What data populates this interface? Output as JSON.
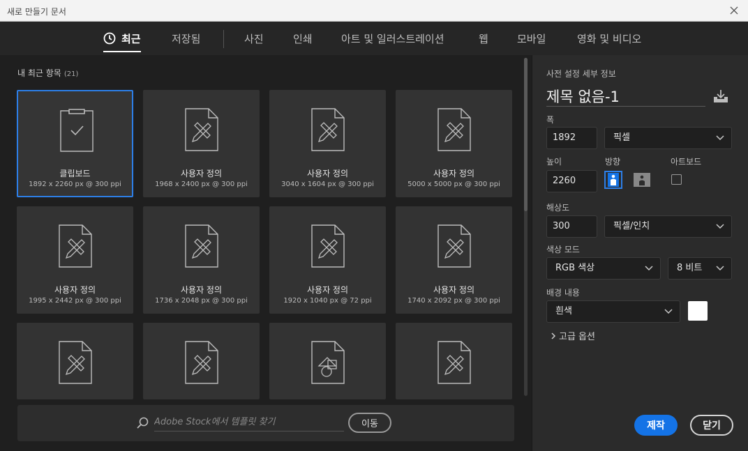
{
  "window": {
    "title": "새로 만들기 문서"
  },
  "tabs": [
    {
      "label": "최근",
      "active": true
    },
    {
      "label": "저장됨"
    },
    {
      "label": "사진"
    },
    {
      "label": "인쇄"
    },
    {
      "label": "아트 및 일러스트레이션"
    },
    {
      "label": "웹"
    },
    {
      "label": "모바일"
    },
    {
      "label": "영화 및 비디오"
    }
  ],
  "recent": {
    "title": "내 최근 항목",
    "count": "(21)",
    "items": [
      {
        "name": "클립보드",
        "dims": "1892 x 2260 px @ 300 ppi",
        "icon": "clipboard-icon"
      },
      {
        "name": "사용자 정의",
        "dims": "1968 x 2400 px @ 300 ppi",
        "icon": "document-pencil-ruler-icon"
      },
      {
        "name": "사용자 정의",
        "dims": "3040 x 1604 px @ 300 ppi",
        "icon": "document-pencil-ruler-icon"
      },
      {
        "name": "사용자 정의",
        "dims": "5000 x 5000 px @ 300 ppi",
        "icon": "document-pencil-ruler-icon"
      },
      {
        "name": "사용자 정의",
        "dims": "1995 x 2442 px @ 300 ppi",
        "icon": "document-pencil-ruler-icon"
      },
      {
        "name": "사용자 정의",
        "dims": "1736 x 2048 px @ 300 ppi",
        "icon": "document-pencil-ruler-icon"
      },
      {
        "name": "사용자 정의",
        "dims": "1920 x 1040 px @ 72 ppi",
        "icon": "document-pencil-ruler-icon"
      },
      {
        "name": "사용자 정의",
        "dims": "1740 x 2092 px @ 300 ppi",
        "icon": "document-pencil-ruler-icon"
      },
      {
        "name": "",
        "dims": "",
        "icon": "document-pencil-ruler-icon"
      },
      {
        "name": "",
        "dims": "",
        "icon": "document-pencil-ruler-icon"
      },
      {
        "name": "",
        "dims": "",
        "icon": "document-shapes-icon"
      },
      {
        "name": "",
        "dims": "",
        "icon": "document-pencil-ruler-icon"
      }
    ]
  },
  "search": {
    "placeholder": "Adobe Stock에서 템플릿 찾기",
    "go_label": "이동"
  },
  "preset": {
    "section_title": "사전 설정 세부 정보",
    "doc_name": "제목 없음-1",
    "width_label": "폭",
    "width_value": "1892",
    "width_unit": "픽셀",
    "height_label": "높이",
    "height_value": "2260",
    "orientation_label": "방향",
    "orientation": "portrait",
    "artboard_label": "아트보드",
    "artboard_checked": false,
    "resolution_label": "해상도",
    "resolution_value": "300",
    "resolution_unit": "픽셀/인치",
    "color_mode_label": "색상 모드",
    "color_mode": "RGB 색상",
    "bit_depth": "8 비트",
    "background_label": "배경 내용",
    "background": "흰색",
    "background_color": "#ffffff",
    "advanced_label": "고급 옵션",
    "create_label": "제작",
    "close_label": "닫기"
  },
  "colors": {
    "accent": "#1473e6",
    "selected_border": "#2d7fe8"
  }
}
